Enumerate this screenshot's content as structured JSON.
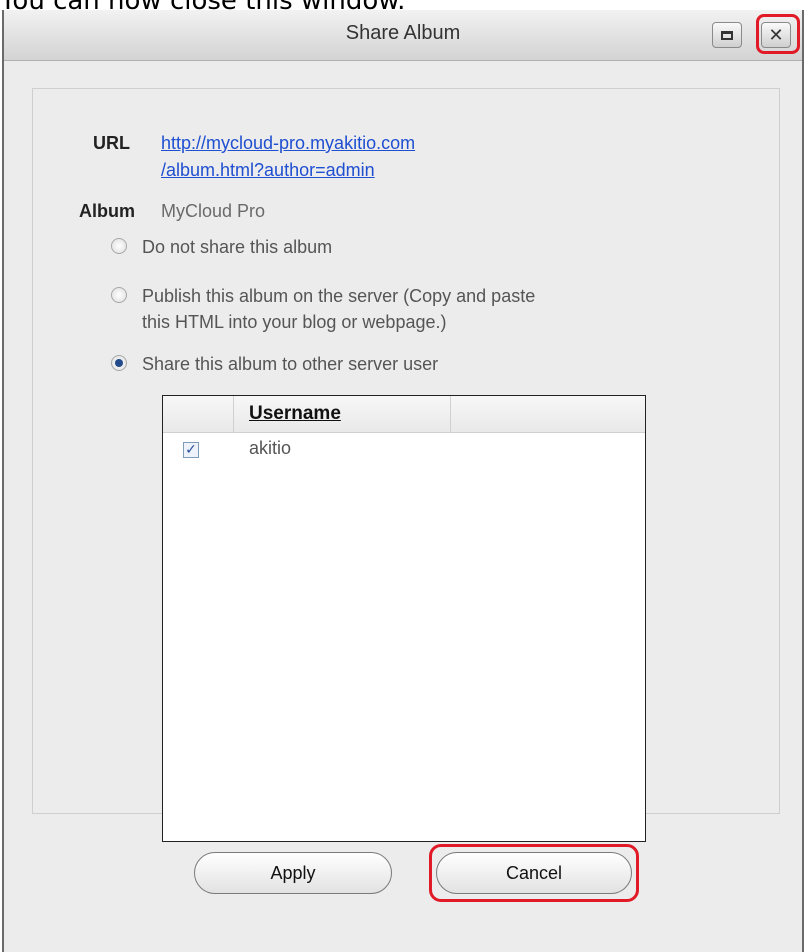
{
  "caption": "You can now close this window.",
  "window": {
    "title": "Share Album",
    "maximize_icon": "maximize-icon",
    "close_icon": "close-icon",
    "close_glyph": "✕"
  },
  "form": {
    "url_label": "URL",
    "url_line1": "http://mycloud-pro.myakitio.com",
    "url_line2": "/album.html?author=admin",
    "album_label": "Album",
    "album_value": "MyCloud Pro",
    "options": [
      {
        "label": "Do not share this album",
        "selected": false
      },
      {
        "label_line1": "Publish this album on the server (Copy and paste",
        "label_line2": "this HTML into your blog or webpage.)",
        "selected": false
      },
      {
        "label": "Share this album to other server user",
        "selected": true
      }
    ]
  },
  "users_table": {
    "column_header": "Username",
    "rows": [
      {
        "username": "akitio",
        "checked": true,
        "check_glyph": "✓"
      }
    ]
  },
  "buttons": {
    "apply": "Apply",
    "cancel": "Cancel"
  },
  "colors": {
    "highlight": "#e01a26",
    "link": "#1f4fd1"
  }
}
